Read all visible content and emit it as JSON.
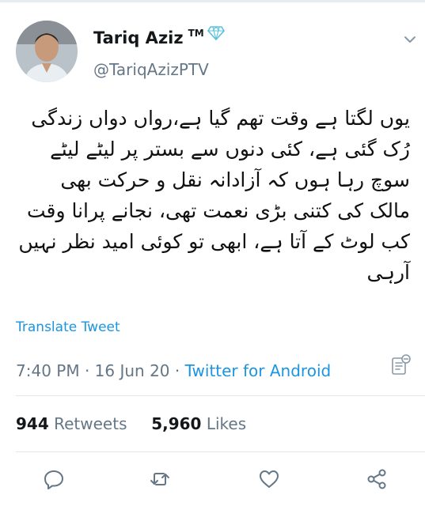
{
  "user": {
    "display_name": "Tariq Aziz",
    "tm": "TM",
    "handle": "@TariqAzizPTV"
  },
  "tweet": {
    "text": "یوں لگتا ہے وقت تھم گیا ہے،رواں دواں زندگی رُک گئی ہے، کئی دنوں سے بستر پر لیٹے لیٹے سوچ رہا ہوں کہ آزادانہ نقل و حرکت بھی مالک کی کتنی بڑی نعمت تھی، نجانے پرانا وقت کب لوٹ کے آتا ہے، ابھی تو کوئی امید نظر نہیں آرہی",
    "translate_label": "Translate Tweet",
    "time": "7:40 PM",
    "date": "16 Jun 20",
    "separator": "·",
    "source": "Twitter for Android"
  },
  "stats": {
    "retweets_count": "944",
    "retweets_label": "Retweets",
    "likes_count": "5,960",
    "likes_label": "Likes"
  },
  "icons": {
    "verified_badge": "diamond-icon",
    "menu": "chevron-down-icon",
    "analytics": "analytics-icon",
    "actions": [
      "reply-icon",
      "retweet-icon",
      "like-icon",
      "share-icon"
    ]
  },
  "colors": {
    "accent": "#1b95e0",
    "secondary_text": "#657786",
    "primary_text": "#14171a",
    "diamond": "#5bc0de"
  }
}
